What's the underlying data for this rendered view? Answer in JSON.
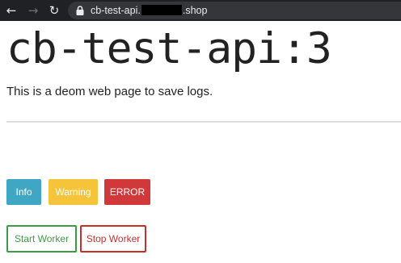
{
  "browser": {
    "url_prefix": "cb-test-api.",
    "url_suffix": ".shop",
    "icons": [
      "back-arrow-icon",
      "forward-arrow-icon",
      "reload-icon",
      "lock-icon"
    ]
  },
  "page": {
    "title": "cb-test-api:3",
    "description": "This is a deom web page to save logs."
  },
  "log_buttons": {
    "info": "Info",
    "warning": "Warning",
    "error": "ERROR"
  },
  "worker_buttons": {
    "start": "Start Worker",
    "stop": "Stop Worker"
  },
  "colors": {
    "info": "#3fa7c4",
    "warning": "#f6c43a",
    "error": "#d1383a",
    "start": "#3d9b45",
    "stop": "#c9302c",
    "browser_bar": "#202124"
  }
}
